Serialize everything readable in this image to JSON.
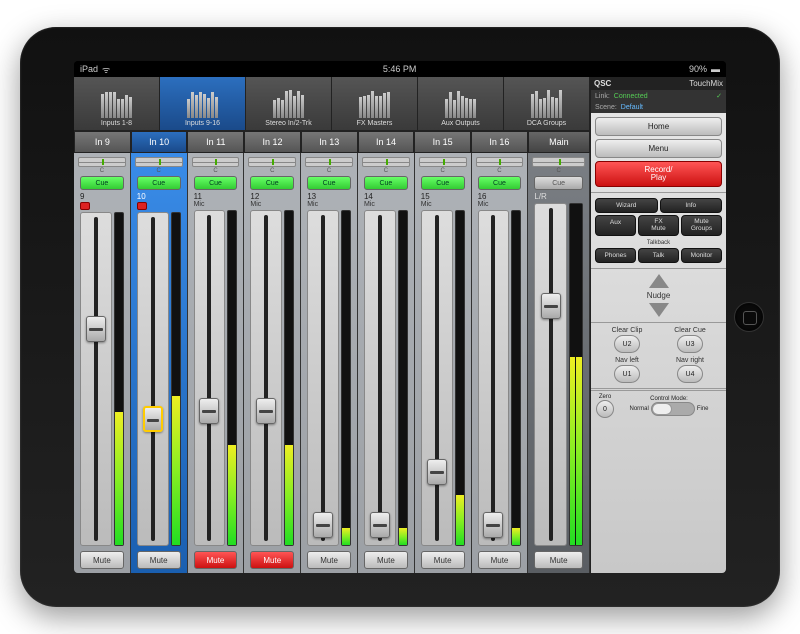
{
  "statusbar": {
    "carrier": "iPad",
    "wifi": "▲",
    "time": "5:46 PM",
    "battery_pct": "90%",
    "battery_icon": "▮"
  },
  "brand": {
    "logo": "QSC",
    "product": "TouchMix"
  },
  "link": {
    "label": "Link:",
    "value": "Connected",
    "ok": true
  },
  "scene": {
    "label": "Scene:",
    "value": "Default"
  },
  "nav": {
    "strips": [
      {
        "label": "Inputs 1-8",
        "active": false
      },
      {
        "label": "Inputs 9-16",
        "active": true
      },
      {
        "label": "Stereo In/2-Trk",
        "active": false
      },
      {
        "label": "FX Masters",
        "active": false
      },
      {
        "label": "Aux Outputs",
        "active": false
      },
      {
        "label": "DCA Groups",
        "active": false
      }
    ]
  },
  "tabs": [
    {
      "label": "In 9"
    },
    {
      "label": "In 10"
    },
    {
      "label": "In 11"
    },
    {
      "label": "In 12"
    },
    {
      "label": "In 13"
    },
    {
      "label": "In 14"
    },
    {
      "label": "In 15"
    },
    {
      "label": "In 16"
    },
    {
      "label": "Main"
    }
  ],
  "channels": [
    {
      "num": "9",
      "name": "",
      "cue": true,
      "mute": false,
      "rec": true,
      "fader": 0.35,
      "meter": 0.4,
      "pan": 0.5
    },
    {
      "num": "10",
      "name": "",
      "cue": true,
      "mute": false,
      "rec": true,
      "fader": 0.62,
      "meter": 0.45,
      "pan": 0.5,
      "selected": true
    },
    {
      "num": "11",
      "name": "Mic",
      "cue": true,
      "mute": true,
      "rec": false,
      "fader": 0.6,
      "meter": 0.3,
      "pan": 0.5
    },
    {
      "num": "12",
      "name": "Mic",
      "cue": true,
      "mute": true,
      "rec": false,
      "fader": 0.6,
      "meter": 0.3,
      "pan": 0.5
    },
    {
      "num": "13",
      "name": "Mic",
      "cue": true,
      "mute": false,
      "rec": false,
      "fader": 0.94,
      "meter": 0.05,
      "pan": 0.5
    },
    {
      "num": "14",
      "name": "Mic",
      "cue": true,
      "mute": false,
      "rec": false,
      "fader": 0.94,
      "meter": 0.05,
      "pan": 0.5
    },
    {
      "num": "15",
      "name": "Mic",
      "cue": true,
      "mute": false,
      "rec": false,
      "fader": 0.78,
      "meter": 0.15,
      "pan": 0.5
    },
    {
      "num": "16",
      "name": "Mic",
      "cue": true,
      "mute": false,
      "rec": false,
      "fader": 0.94,
      "meter": 0.05,
      "pan": 0.5
    }
  ],
  "main": {
    "label": "L/R",
    "cue": false,
    "mute": false,
    "fader": 0.3,
    "meter_l": 0.55,
    "meter_r": 0.55
  },
  "cue_label": "Cue",
  "mute_label": "Mute",
  "pan_center": "C",
  "sidebar": {
    "home": "Home",
    "menu": "Menu",
    "record": "Record/\nPlay",
    "wizard": "Wizard",
    "info": "Info",
    "aux": "Aux",
    "fxmute": "FX\nMute",
    "mutegroups": "Mute\nGroups",
    "phones": "Phones",
    "talk": "Talk",
    "monitor": "Monitor",
    "talkback": "Talkback",
    "nudge": "Nudge",
    "clear_clip": "Clear Clip",
    "u2": "U2",
    "clear_cue": "Clear Cue",
    "u3": "U3",
    "nav_left": "Nav left",
    "u1": "U1",
    "nav_right": "Nav right",
    "u4": "U4",
    "zero": "Zero",
    "zero_val": "0",
    "control_mode": "Control Mode:",
    "normal": "Normal",
    "fine": "Fine"
  }
}
